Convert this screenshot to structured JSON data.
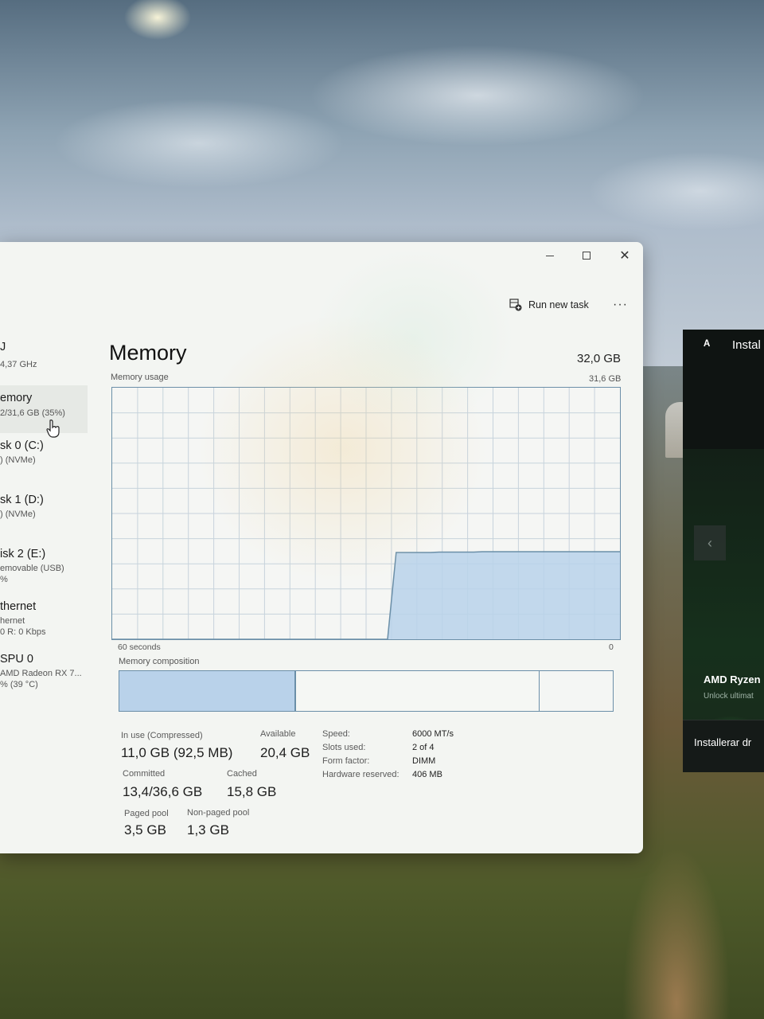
{
  "desktop": {
    "amd_panel": {
      "title": "Instal",
      "product": "AMD Ryzen",
      "tagline": "Unlock ultimat",
      "install_label": "Installerar dr"
    }
  },
  "window": {
    "toolbar": {
      "run_new_task": "Run new task",
      "more": "···"
    }
  },
  "sidebar": {
    "items": [
      {
        "name": "J",
        "sub1": "4,37 GHz",
        "sub2": ""
      },
      {
        "name": "emory",
        "sub1": "2/31,6 GB (35%)",
        "sub2": ""
      },
      {
        "name": "sk 0 (C:)",
        "sub1": ") (NVMe)",
        "sub2": ""
      },
      {
        "name": "sk 1 (D:)",
        "sub1": ") (NVMe)",
        "sub2": ""
      },
      {
        "name": "isk 2 (E:)",
        "sub1": "emovable (USB)",
        "sub2": "%"
      },
      {
        "name": "thernet",
        "sub1": "hernet",
        "sub2": "0 R: 0 Kbps"
      },
      {
        "name": "SPU 0",
        "sub1": "AMD Radeon RX 7...",
        "sub2": "% (39 °C)"
      }
    ]
  },
  "memory": {
    "title": "Memory",
    "total": "32,0 GB",
    "usage_label": "Memory usage",
    "usage_max": "31,6 GB",
    "axis_left": "60 seconds",
    "axis_right": "0",
    "composition_label": "Memory composition",
    "stats": {
      "in_use_label": "In use (Compressed)",
      "in_use_value": "11,0 GB (92,5 MB)",
      "available_label": "Available",
      "available_value": "20,4 GB",
      "committed_label": "Committed",
      "committed_value": "13,4/36,6 GB",
      "cached_label": "Cached",
      "cached_value": "15,8 GB",
      "paged_pool_label": "Paged pool",
      "paged_pool_value": "3,5 GB",
      "non_paged_pool_label": "Non-paged pool",
      "non_paged_pool_value": "1,3 GB"
    },
    "specs": {
      "speed_label": "Speed:",
      "speed_value": "6000 MT/s",
      "slots_label": "Slots used:",
      "slots_value": "2 of 4",
      "form_label": "Form factor:",
      "form_value": "DIMM",
      "reserved_label": "Hardware reserved:",
      "reserved_value": "406 MB"
    }
  },
  "chart_data": {
    "type": "area",
    "x_range_seconds": [
      60,
      0
    ],
    "y_range_gb": [
      0,
      31.6
    ],
    "series": [
      {
        "values_gb": [
          0,
          0,
          0,
          0,
          0,
          0,
          0,
          0,
          0,
          0,
          0,
          0,
          0,
          0,
          0,
          0,
          0,
          0,
          0,
          0,
          0,
          0,
          0,
          0,
          0,
          0,
          0,
          0,
          0,
          0,
          0,
          0,
          0,
          10.9,
          10.9,
          10.9,
          10.9,
          10.9,
          10.95,
          10.95,
          10.95,
          10.95,
          10.95,
          11.0,
          11.0,
          11.0,
          11.0,
          11.0,
          11.0,
          11.0,
          11.0,
          11.0,
          11.0,
          11.0,
          11.0,
          11.0,
          11.0,
          11.0,
          11.0,
          11.0
        ]
      }
    ],
    "composition": {
      "in_use_fraction": 0.35,
      "standby_fraction": 0.5
    },
    "grid": true
  },
  "colors": {
    "graph_border": "#6b8fa8",
    "graph_fill": "#b9d2ea",
    "grid": "#c7d3dc"
  }
}
